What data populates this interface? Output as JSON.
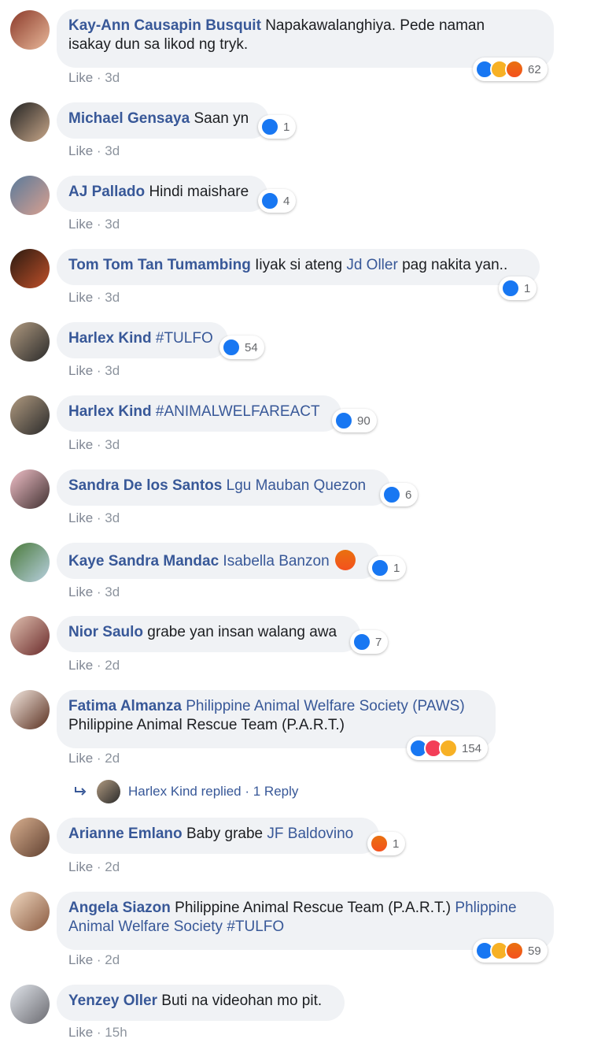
{
  "comments": [
    {
      "author": "Kay-Ann Causapin Busquit",
      "text": "Napakawalanghiya. Pede naman",
      "text2": "isakay dun sa likod ng tryk.",
      "time": "3d",
      "like": "Like",
      "reactions": "62"
    },
    {
      "author": "Michael Gensaya",
      "text": "Saan yn",
      "time": "3d",
      "like": "Like",
      "reactions": "1"
    },
    {
      "author": "AJ Pallado",
      "text": "Hindi maishare",
      "time": "3d",
      "like": "Like",
      "reactions": "4"
    },
    {
      "author": "Tom Tom Tan Tumambing",
      "text": "Iiyak si ateng",
      "mention": "Jd Oller",
      "text_after": "pag nakita yan..",
      "time": "3d",
      "like": "Like",
      "reactions": "1"
    },
    {
      "author": "Harlex Kind",
      "mention": "#TULFO",
      "time": "3d",
      "like": "Like",
      "reactions": "54"
    },
    {
      "author": "Harlex Kind",
      "mention": "#ANIMALWELFAREACT",
      "time": "3d",
      "like": "Like",
      "reactions": "90"
    },
    {
      "author": "Sandra De los Santos",
      "mention": "Lgu Mauban Quezon",
      "time": "3d",
      "like": "Like",
      "reactions": "6"
    },
    {
      "author": "Kaye Sandra Mandac",
      "mention": "Isabella Banzon",
      "time": "3d",
      "like": "Like",
      "reactions": "1"
    },
    {
      "author": "Nior Saulo",
      "text": "grabe yan insan walang awa",
      "time": "2d",
      "like": "Like",
      "reactions": "7"
    },
    {
      "author": "Fatima Almanza",
      "mention": "Philippine Animal Welfare Society (PAWS)",
      "text2": "Philippine Animal Rescue Team (P.A.R.T.)",
      "time": "2d",
      "like": "Like",
      "reactions": "154"
    },
    {
      "author": "Arianne Emlano",
      "text": "Baby grabe",
      "mention": "JF Baldovino",
      "time": "2d",
      "like": "Like",
      "reactions": "1"
    },
    {
      "author": "Angela Siazon",
      "text": "Philippine Animal Rescue Team (P.A.R.T.)",
      "mention": "Phlippine",
      "mention2": "Animal Welfare Society #TULFO",
      "time": "2d",
      "like": "Like",
      "reactions": "59"
    },
    {
      "author": "Yenzey Oller",
      "text": "Buti na videohan mo pit.",
      "time": "15h",
      "like": "Like"
    }
  ],
  "reply": {
    "text": "Harlex Kind replied · 1 Reply"
  },
  "separator": " · ",
  "colors": {
    "link": "#385898",
    "bubble": "#f0f2f5",
    "like": "#1877f2"
  }
}
